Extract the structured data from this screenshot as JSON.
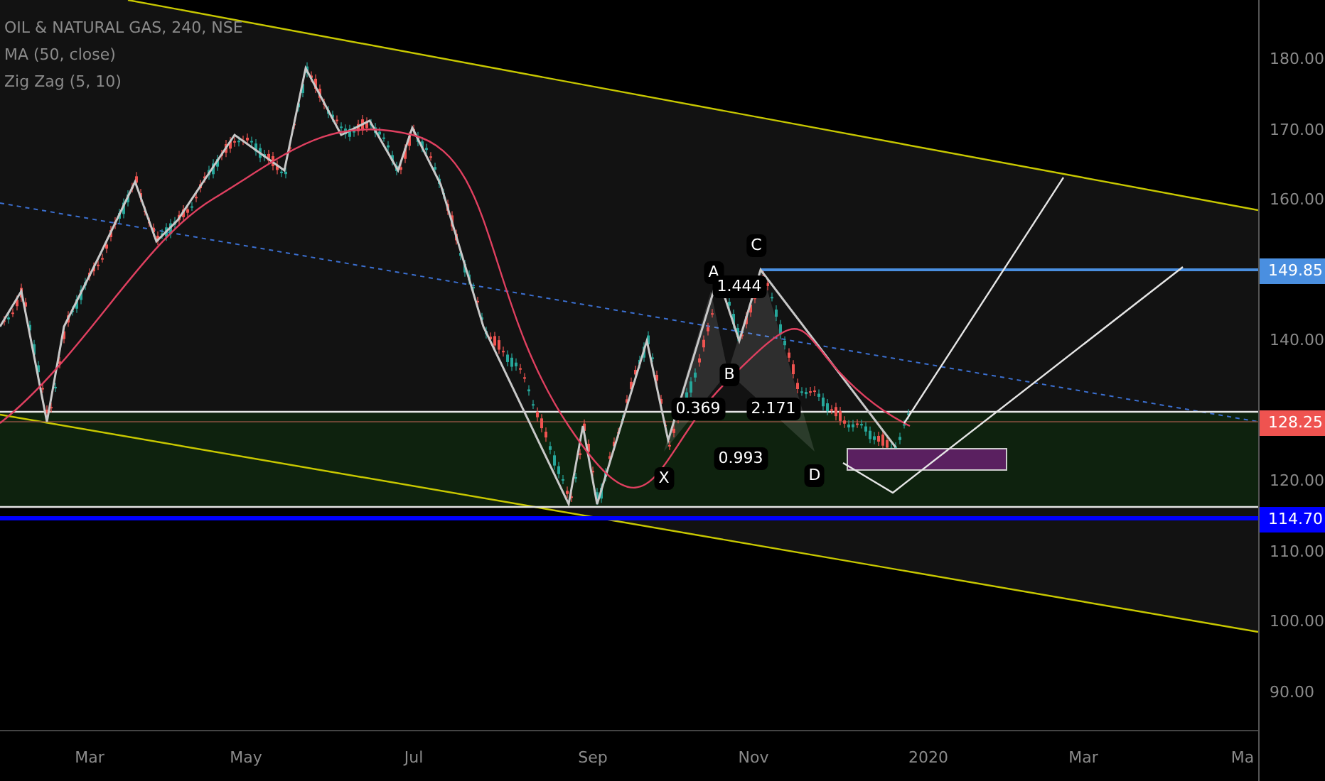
{
  "legend": {
    "title": "OIL & NATURAL GAS, 240, NSE",
    "indicators": [
      "MA (50, close)",
      "Zig Zag (5, 10)"
    ]
  },
  "pattern_labels": [
    {
      "text": "A"
    },
    {
      "text": "C"
    },
    {
      "text": "1.444"
    },
    {
      "text": "B"
    },
    {
      "text": "0.369"
    },
    {
      "text": "2.171"
    },
    {
      "text": "0.993"
    },
    {
      "text": "X"
    },
    {
      "text": "D"
    }
  ],
  "price_axis": {
    "ticks": [
      "180.00",
      "170.00",
      "160.00",
      "140.00",
      "120.00",
      "110.00",
      "100.00",
      "90.00"
    ],
    "tags": [
      {
        "text": "149.85",
        "color": "#4a8fe0"
      },
      {
        "text": "128.25",
        "color": "#ef5350"
      },
      {
        "text": "114.70",
        "color": "#0000ff"
      }
    ]
  },
  "time_axis": {
    "labels": [
      "Mar",
      "May",
      "Jul",
      "Sep",
      "Nov",
      "2020",
      "Mar",
      "Ma"
    ]
  }
}
